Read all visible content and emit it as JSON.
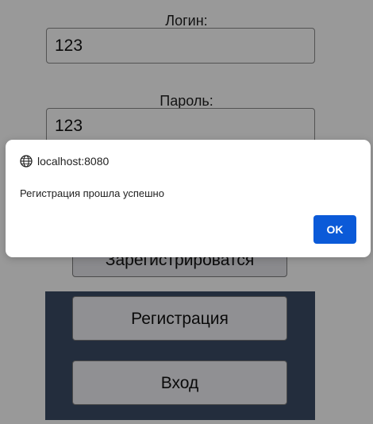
{
  "form": {
    "login_label": "Логин:",
    "login_value": "123",
    "password_label": "Пароль:",
    "password_value": "123",
    "register_submit_label": "Зарегистрироватся"
  },
  "nav": {
    "registration_label": "Регистрация",
    "login_label": "Вход"
  },
  "dialog": {
    "origin": "localhost:8080",
    "origin_icon": "globe-icon",
    "message": "Регистрация прошла успешно",
    "ok_label": "OK"
  },
  "colors": {
    "overlay": "rgba(0,0,0,0.40)",
    "nav_panel": "#3b4b66",
    "ok_button": "#0b5ad8"
  }
}
